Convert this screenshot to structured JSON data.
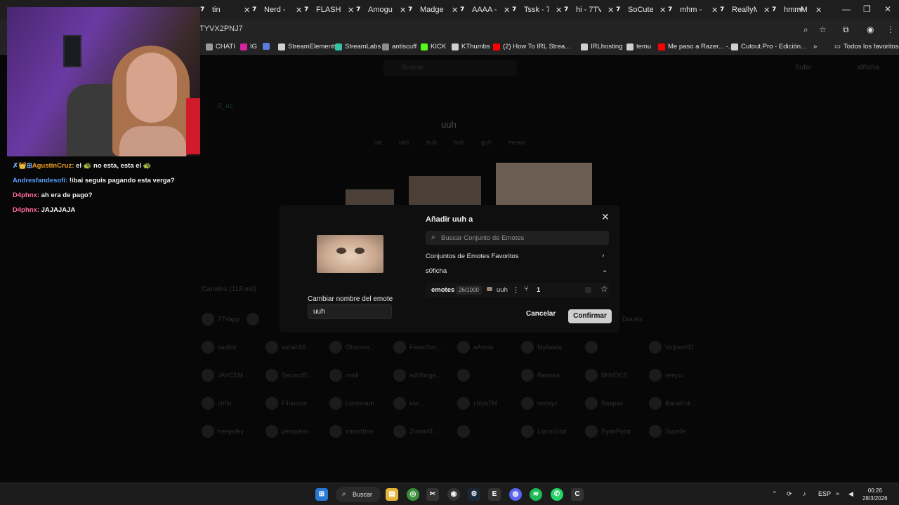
{
  "browser": {
    "tabs": [
      {
        "label": "tin",
        "icon": "7tv-logo-icon"
      },
      {
        "label": "Nerd -",
        "icon": "7tv-logo-icon"
      },
      {
        "label": "FLASHI",
        "icon": "7tv-logo-icon"
      },
      {
        "label": "Amogu",
        "icon": "7tv-logo-icon"
      },
      {
        "label": "Madge",
        "icon": "7tv-logo-icon"
      },
      {
        "label": "AAAA -",
        "icon": "7tv-logo-icon"
      },
      {
        "label": "Tssk - 7",
        "icon": "7tv-logo-icon"
      },
      {
        "label": "hi - 7TV",
        "icon": "7tv-logo-icon"
      },
      {
        "label": "SoCute",
        "icon": "7tv-logo-icon"
      },
      {
        "label": "mhm -",
        "icon": "7tv-logo-icon"
      },
      {
        "label": "ReallyM",
        "icon": "7tv-logo-icon"
      },
      {
        "label": "hmmM",
        "icon": "7tv-logo-icon"
      }
    ],
    "url": "TYVX2PNJ7",
    "bookmarks": [
      {
        "label": "CHATI",
        "color": "#9a9a9a"
      },
      {
        "label": "IG",
        "color": "#d6249f"
      },
      {
        "label": "",
        "color": "#5a7bd8"
      },
      {
        "label": "StreamElements",
        "color": "#cfcfcf"
      },
      {
        "label": "StreamLabs",
        "color": "#31c3a2"
      },
      {
        "label": "antiscuff",
        "color": "#8b8b8b"
      },
      {
        "label": "KICK",
        "color": "#53fc18"
      },
      {
        "label": "KThumbs",
        "color": "#cfcfcf"
      },
      {
        "label": "(2) How To IRL Strea...",
        "color": "#ff0000"
      },
      {
        "label": "IRLhosting",
        "color": "#cfcfcf"
      },
      {
        "label": "temu",
        "color": "#cfcfcf"
      },
      {
        "label": "Me paso a Razer... -...",
        "color": "#ff0000"
      },
      {
        "label": "Cutout.Pro - Edición...",
        "color": "#cfcfcf"
      }
    ],
    "bookmarks_overflow": "»",
    "all_favorites": "Todos los favoritos"
  },
  "chat": [
    {
      "user": "AgustinCruz:",
      "badges": "✗👑⊞",
      "user_color": "#f0a020",
      "message": "el 🐢 no esta, esta el 🐢"
    },
    {
      "user": "Andresfandesofi:",
      "badges": "",
      "user_color": "#5aa0ff",
      "message": "!ibai seguis pagando esta verga?"
    },
    {
      "user": "D4phnx:",
      "badges": "",
      "user_color": "#ff6a9a",
      "message": "ah era de pago?"
    },
    {
      "user": "D4phnx:",
      "badges": "",
      "user_color": "#ff6a9a",
      "message": "JAJAJAJA"
    }
  ],
  "page": {
    "search_placeholder": "Buscar",
    "upload": "Subir",
    "user": "s0ficha",
    "owner": "0_uc",
    "emote_title": "uuh",
    "tags": [
      "cat",
      "uhh",
      "huh",
      "buh",
      "guh",
      "meow"
    ],
    "channels_header": "Canales (118 mil)",
    "channels": [
      [
        "7TVapp",
        "",
        "",
        "",
        "",
        "",
        "",
        "",
        "",
        "Dranks"
      ],
      [
        "sadifor",
        "ashah58",
        "Obscure...",
        "FeuisSun...",
        "aAstria",
        "Myllalala",
        "",
        "VulpesHD"
      ],
      [
        "JAYCEM...",
        "SecondS...",
        "nnkll",
        "ad0thoga...",
        "",
        "Retnora",
        "BHVDES",
        "veryxx"
      ],
      [
        "ch0n",
        "Filunovie",
        "Lordmauh",
        "kiw...",
        "chipsTM",
        "nerlayz",
        "Raapax",
        "IllanoKok..."
      ],
      [
        "treejadey",
        "pentalexs",
        "mmsttbrw",
        "ZonanM...",
        "",
        "LiptonGod",
        "RyanPotat",
        "Supelle"
      ]
    ]
  },
  "modal": {
    "title": "Añadir uuh a",
    "search_placeholder": "Buscar Conjunto de Emotes",
    "favorites_label": "Conjuntos de Emotes Favoritos",
    "owner_label": "s0ficha",
    "set": {
      "name": "emotes",
      "count": "26/1000",
      "emote_name": "uuh",
      "branch_count": "1"
    },
    "rename_label": "Cambiar nombre del emote",
    "rename_value": "uuh",
    "cancel": "Cancelar",
    "confirm": "Confirmar"
  },
  "taskbar": {
    "search": "Buscar",
    "lang": "ESP",
    "time": "00:26",
    "date": "28/3/2026",
    "whatsapp_badge": "12"
  }
}
